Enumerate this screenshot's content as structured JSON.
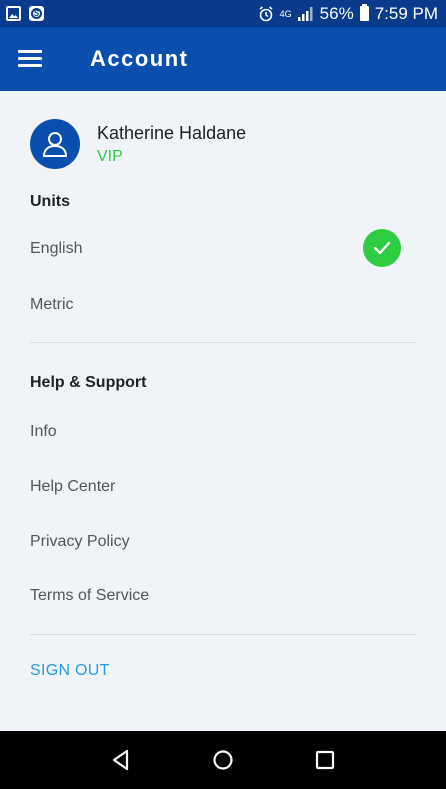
{
  "status_bar": {
    "left_icons": [
      "image-icon",
      "skype-icon"
    ],
    "signal_label": "4G",
    "battery": "56%",
    "time": "7:59 PM"
  },
  "app_bar": {
    "title": "Account"
  },
  "profile": {
    "name": "Katherine Haldane",
    "tier": "VIP"
  },
  "units": {
    "title": "Units",
    "options": [
      {
        "label": "English",
        "selected": true
      },
      {
        "label": "Metric",
        "selected": false
      }
    ]
  },
  "help": {
    "title": "Help & Support",
    "items": [
      "Info",
      "Help Center",
      "Privacy Policy",
      "Terms of Service"
    ]
  },
  "sign_out": "SIGN OUT",
  "colors": {
    "status_bar": "#0a3a8c",
    "app_bar": "#0b4fae",
    "background": "#f0f4f8",
    "vip_green": "#2ecc40",
    "check_green": "#2ecc40",
    "link_blue": "#2a9be0"
  }
}
